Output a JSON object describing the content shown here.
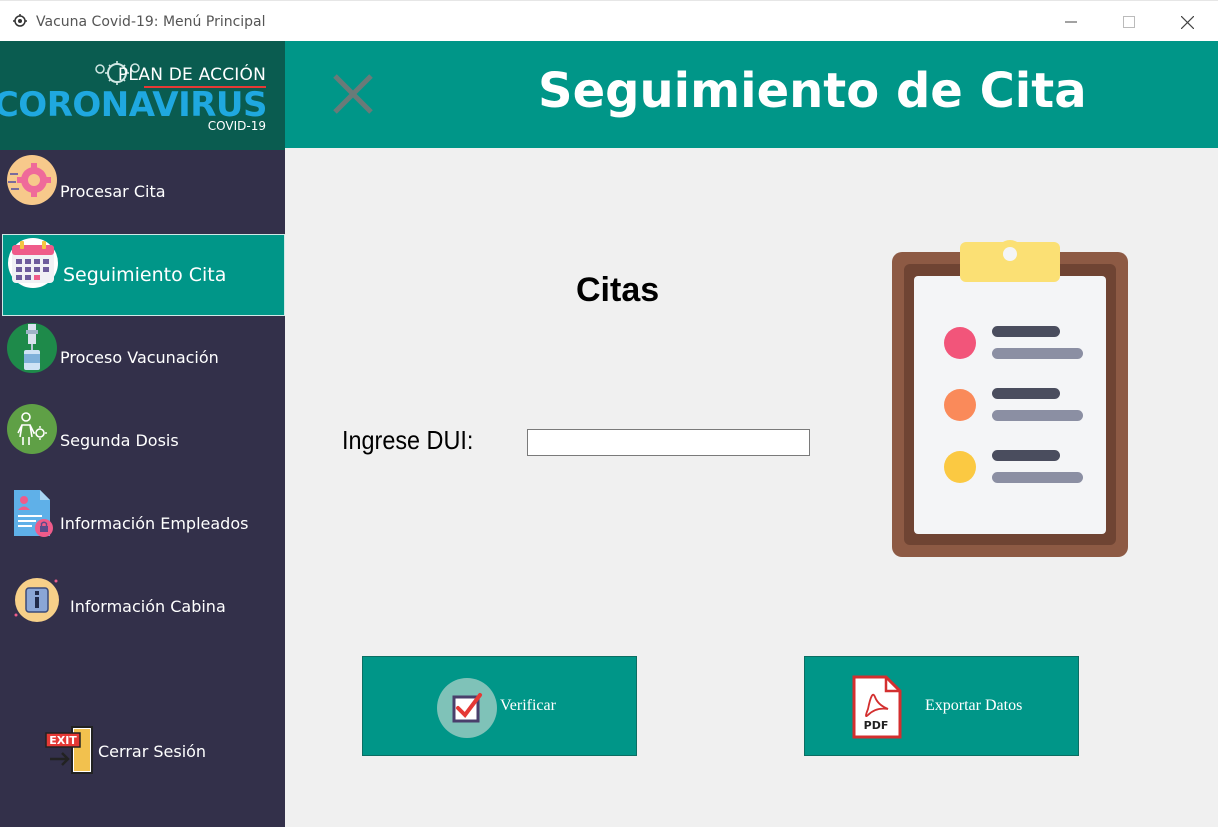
{
  "window": {
    "title": "Vacuna Covid-19: Menú Principal",
    "controls": [
      "minimize-icon",
      "maximize-icon",
      "close-icon"
    ]
  },
  "logo": {
    "plan": "PLAN DE ACCIÓN",
    "name": "CORONAVIRUS",
    "sub": "COVID-19"
  },
  "sidebar": {
    "items": [
      {
        "label": "Procesar Cita",
        "icon": "gear-icon",
        "active": false
      },
      {
        "label": "Seguimiento Cita",
        "icon": "calendar-icon",
        "active": true
      },
      {
        "label": "Proceso Vacunación",
        "icon": "vaccine-icon",
        "active": false
      },
      {
        "label": "Segunda Dosis",
        "icon": "person-virus-icon",
        "active": false
      },
      {
        "label": "Información Empleados",
        "icon": "employee-document-icon",
        "active": false
      },
      {
        "label": "Información Cabina",
        "icon": "info-icon",
        "active": false
      }
    ],
    "logout_label": "Cerrar Sesión"
  },
  "header": {
    "title": "Seguimiento de Cita"
  },
  "main": {
    "section_title": "Citas",
    "dui_label": "Ingrese DUI:",
    "dui_value": "",
    "verify_label": "Verificar",
    "export_label": "Exportar Datos",
    "pdf_badge": "PDF"
  },
  "colors": {
    "teal": "#009688",
    "sidebar": "#33304a",
    "logo_bg": "#0a5c50",
    "content_bg": "#f0f0f0"
  }
}
